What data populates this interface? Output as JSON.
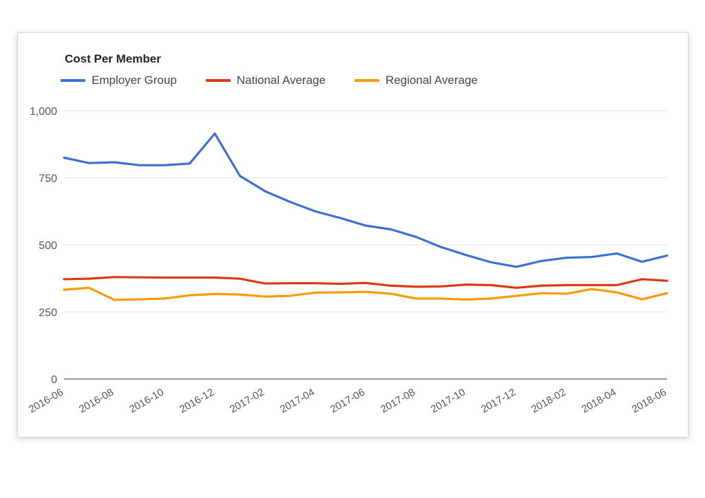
{
  "card": {
    "title": "Cost Per Member"
  },
  "legend": [
    {
      "label": "Employer Group",
      "color": "#3c6fd1",
      "icon": "line-swatch-icon"
    },
    {
      "label": "National Average",
      "color": "#dc3912",
      "icon": "line-swatch-icon"
    },
    {
      "label": "Regional Average",
      "color": "#ff9900",
      "icon": "line-swatch-icon"
    }
  ],
  "axes": {
    "y_ticks": [
      "0",
      "250",
      "500",
      "750",
      "1,000"
    ],
    "x_ticks": [
      "2016-06",
      "2016-08",
      "2016-10",
      "2016-12",
      "2017-02",
      "2017-04",
      "2017-06",
      "2017-08",
      "2017-10",
      "2017-12",
      "2018-02",
      "2018-04",
      "2018-06"
    ]
  },
  "chart_data": {
    "type": "line",
    "title": "Cost Per Member",
    "xlabel": "",
    "ylabel": "",
    "ylim": [
      0,
      1000
    ],
    "ytick_values": [
      0,
      250,
      500,
      750,
      1000
    ],
    "grid": true,
    "legend_position": "top-left",
    "x": [
      "2016-06",
      "2016-07",
      "2016-08",
      "2016-09",
      "2016-10",
      "2016-11",
      "2016-12",
      "2017-01",
      "2017-02",
      "2017-03",
      "2017-04",
      "2017-05",
      "2017-06",
      "2017-07",
      "2017-08",
      "2017-09",
      "2017-10",
      "2017-11",
      "2017-12",
      "2018-01",
      "2018-02",
      "2018-03",
      "2018-04",
      "2018-05",
      "2018-06"
    ],
    "series": [
      {
        "name": "Employer Group",
        "color": "#3c6fd1",
        "values": [
          825,
          805,
          808,
          797,
          797,
          803,
          915,
          757,
          700,
          660,
          625,
          600,
          572,
          558,
          530,
          492,
          462,
          435,
          418,
          440,
          452,
          455,
          468,
          437,
          460
        ]
      },
      {
        "name": "National Average",
        "color": "#dc3912",
        "values": [
          372,
          374,
          380,
          379,
          378,
          378,
          378,
          374,
          356,
          357,
          357,
          355,
          358,
          348,
          344,
          345,
          352,
          350,
          340,
          348,
          350,
          350,
          350,
          372,
          366
        ]
      },
      {
        "name": "Regional Average",
        "color": "#ff9900",
        "values": [
          333,
          340,
          295,
          297,
          300,
          312,
          317,
          315,
          307,
          310,
          322,
          323,
          325,
          318,
          300,
          300,
          296,
          300,
          310,
          320,
          318,
          335,
          323,
          297,
          320
        ]
      }
    ]
  }
}
